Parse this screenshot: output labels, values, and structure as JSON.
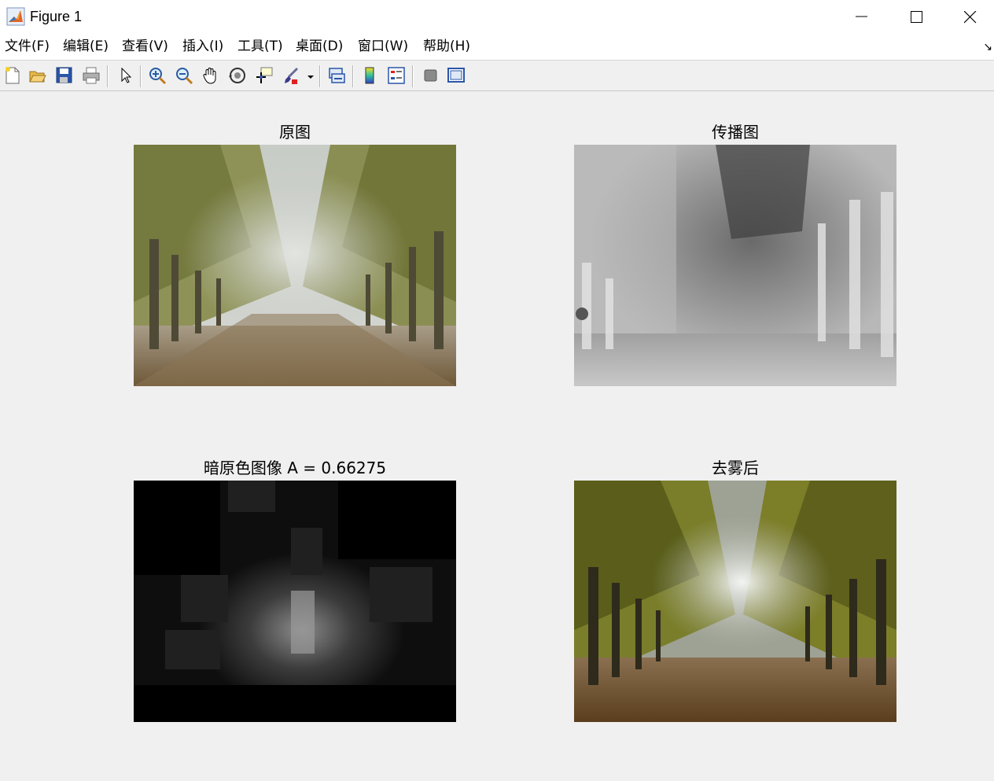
{
  "window": {
    "title": "Figure 1",
    "icon": "matlab-logo-icon",
    "controls": [
      "minimize-icon",
      "maximize-icon",
      "close-icon"
    ]
  },
  "menubar": {
    "items": [
      {
        "label": "文件(F)"
      },
      {
        "label": "编辑(E)"
      },
      {
        "label": "查看(V)"
      },
      {
        "label": "插入(I)"
      },
      {
        "label": "工具(T)"
      },
      {
        "label": "桌面(D)"
      },
      {
        "label": "窗口(W)"
      },
      {
        "label": "帮助(H)"
      }
    ],
    "dock_icon": "↘"
  },
  "toolbar": {
    "tools": [
      "new-figure-icon",
      "open-file-icon",
      "save-icon",
      "print-icon",
      "select-arrow-icon",
      "zoom-in-icon",
      "zoom-out-icon",
      "pan-hand-icon",
      "rotate-3d-icon",
      "data-cursor-icon",
      "brush-icon",
      "brush-dropdown-icon",
      "link-plot-icon",
      "colorbar-icon",
      "legend-icon",
      "hide-plot-tools-icon",
      "show-plot-tools-icon"
    ]
  },
  "axes": [
    {
      "title": "原图",
      "image": "foggy tree-lined path, original"
    },
    {
      "title": "传播图",
      "image": "grayscale transmission map"
    },
    {
      "title": "暗原色图像 A = 0.66275",
      "image": "dark channel image"
    },
    {
      "title": "去雾后",
      "image": "dehazed tree-lined path"
    }
  ],
  "colors": {
    "background": "#f0f0f0",
    "titlebar": "#ffffff",
    "foliage": "#8a8a3a",
    "fog": "#d8dad6",
    "ground": "#7a6240"
  }
}
